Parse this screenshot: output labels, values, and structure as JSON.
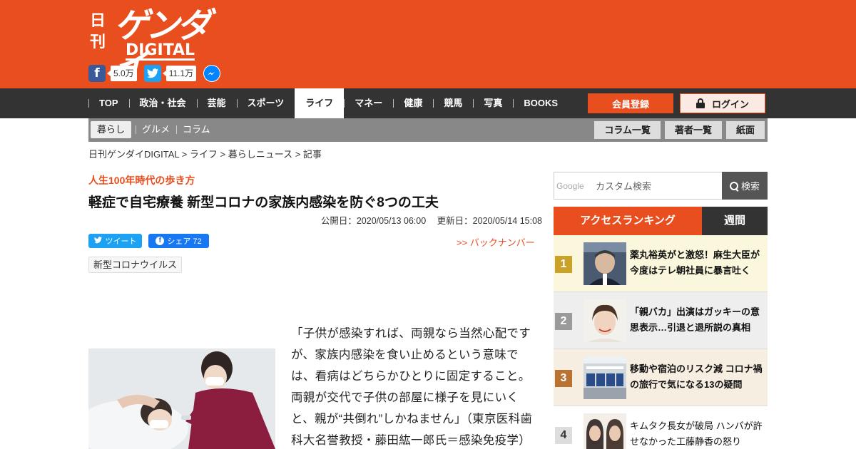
{
  "logo": {
    "nikkan": "日刊",
    "brand": "ゲンダイ",
    "sub": "DIGITAL"
  },
  "social": {
    "facebook_count": "5.0万",
    "twitter_count": "11.1万"
  },
  "nav": {
    "items": [
      "TOP",
      "政治・社会",
      "芸能",
      "スポーツ",
      "ライフ",
      "マネー",
      "健康",
      "競馬",
      "写真",
      "BOOKS"
    ],
    "active": "ライフ",
    "register": "会員登録",
    "login": "ログイン"
  },
  "subnav": {
    "items": [
      "暮らし",
      "グルメ",
      "コラム"
    ],
    "buttons": [
      "コラム一覧",
      "著者一覧",
      "紙面"
    ]
  },
  "breadcrumb": "日刊ゲンダイDIGITAL > ライフ > 暮らしニュース > 記事",
  "article": {
    "series": "人生100年時代の歩き方",
    "title": "軽症で自宅療養 新型コロナの家族内感染を防ぐ8つの工夫",
    "published": "公開日：2020/05/13 06:00",
    "updated": "更新日：2020/05/14 15:08",
    "tweet": "ツイート",
    "share": "シェア 72",
    "backnumber": ">> バックナンバー",
    "tag": "新型コロナウイルス",
    "body": "「子供が感染すれば、両親なら当然心配ですが、家族内感染を食い止めるという意味では、看病はどちらかひとりに固定すること。両親が交代で子供の部屋に様子を見にいくと、親が“共倒れ”しかねません」（東京医科歯科大名誉教授・藤田紘一郎氏＝感染免疫学）"
  },
  "search": {
    "google_label": "Google",
    "placeholder": "カスタム検索",
    "button": "検索"
  },
  "ranking": {
    "tab_access": "アクセスランキング",
    "tab_week": "週間",
    "items": [
      {
        "rank": "1",
        "title": "薬丸裕英がと激怒！麻生大臣が今度はテレ朝社員に暴言吐く"
      },
      {
        "rank": "2",
        "title": "「親バカ」出演はガッキーの意思表示…引退と退所説の真相"
      },
      {
        "rank": "3",
        "title": "移動や宿泊のリスク減 コロナ禍の旅行で気になる13の疑問"
      },
      {
        "rank": "4",
        "title": "キムタク長女が破局 ハンパが許せなかった工藤静香の怒り"
      }
    ]
  },
  "colors": {
    "brand": "#e84e1e",
    "nav_bg": "#333333",
    "subnav_bg": "#888888"
  }
}
